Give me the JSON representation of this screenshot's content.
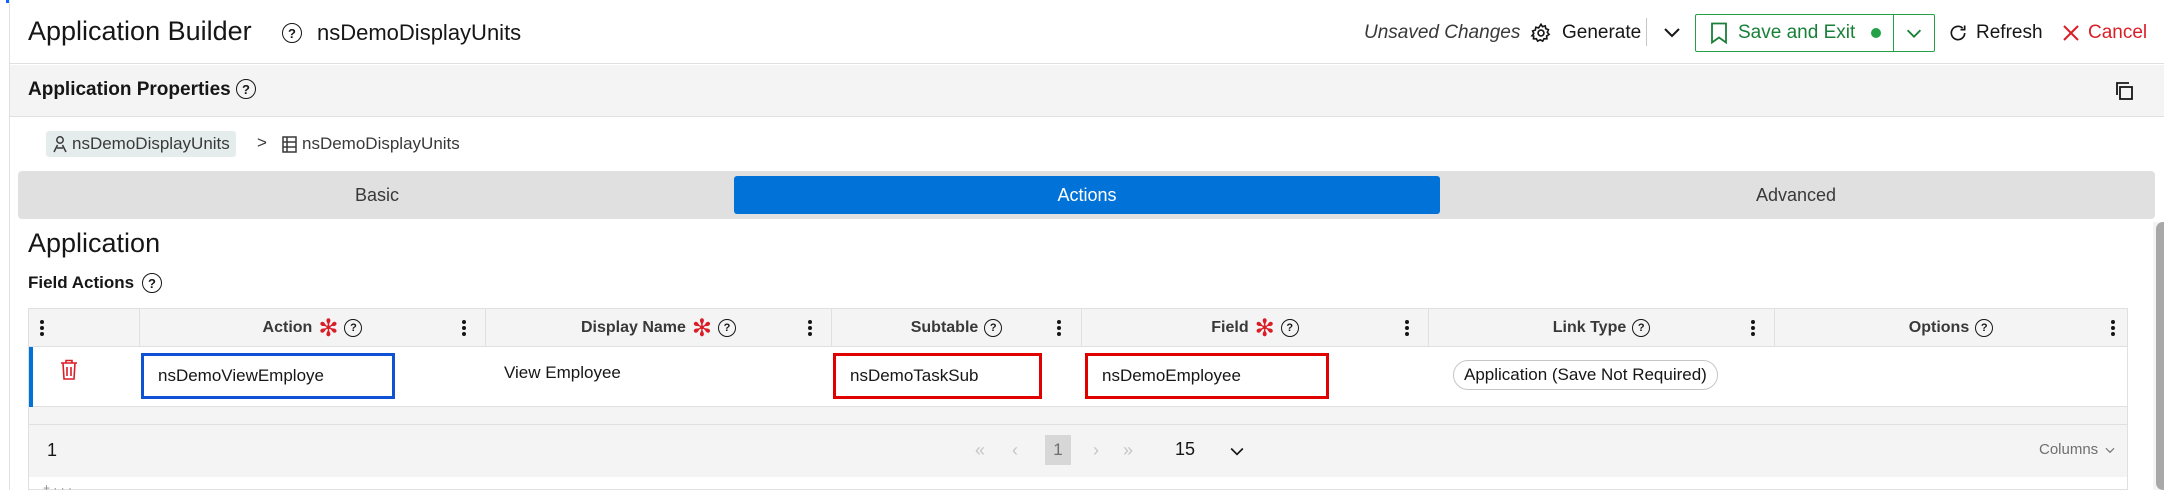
{
  "colors": {
    "accent_blue": "#0072d8",
    "strip_blue": "#0f62fe",
    "strip_purple": "#8a3ffc",
    "strip_teal": "#08bdba",
    "success_green": "#24a148",
    "danger_red": "#da1e28",
    "highlight_blue": "#0f52d6",
    "highlight_red": "#e00000"
  },
  "header": {
    "title": "Application Builder",
    "app_name": "nsDemoDisplayUnits",
    "status": "Unsaved Changes",
    "generate_label": "Generate",
    "save_exit_label": "Save and Exit",
    "refresh_label": "Refresh",
    "cancel_label": "Cancel"
  },
  "properties": {
    "title": "Application Properties"
  },
  "breadcrumb": {
    "items": [
      {
        "label": "nsDemoDisplayUnits",
        "icon": "user-app-icon"
      },
      {
        "label": "nsDemoDisplayUnits",
        "icon": "table-icon"
      }
    ],
    "separator": ">"
  },
  "tabs": [
    {
      "label": "Basic",
      "active": false
    },
    {
      "label": "Actions",
      "active": true
    },
    {
      "label": "Advanced",
      "active": false
    }
  ],
  "section": {
    "title": "Application",
    "subtitle": "Field Actions"
  },
  "table": {
    "columns": [
      {
        "label": "Action",
        "required": true,
        "help": true
      },
      {
        "label": "Display Name",
        "required": true,
        "help": true
      },
      {
        "label": "Subtable",
        "required": false,
        "help": true
      },
      {
        "label": "Field",
        "required": true,
        "help": true
      },
      {
        "label": "Link Type",
        "required": false,
        "help": true
      },
      {
        "label": "Options",
        "required": false,
        "help": true
      }
    ],
    "rows": [
      {
        "action": "nsDemoViewEmploye",
        "display_name": "View Employee",
        "subtable": "nsDemoTaskSub",
        "field": "nsDemoEmployee",
        "link_type": "Application (Save Not Required)",
        "options": ""
      }
    ],
    "pager": {
      "count": "1",
      "current_page": "1",
      "page_size": "15",
      "columns_label": "Columns"
    }
  }
}
